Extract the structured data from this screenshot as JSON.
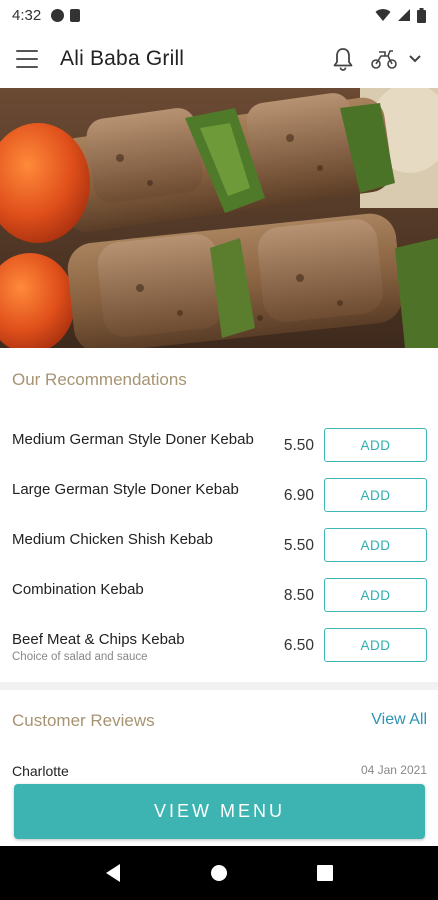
{
  "status_bar": {
    "time": "4:32",
    "icons_left": [
      "circle-icon",
      "card-icon"
    ],
    "icons_right": [
      "wifi-icon",
      "signal-icon",
      "battery-icon"
    ]
  },
  "app_bar": {
    "title": "Ali Baba Grill",
    "icons": [
      "menu-icon",
      "bell-icon",
      "delivery-scooter-icon",
      "chevron-down-icon"
    ]
  },
  "hero": {
    "image": "kebab skewers photo"
  },
  "recommendations": {
    "title": "Our Recommendations",
    "add_label": "ADD",
    "items": [
      {
        "name": "Medium German Style Doner Kebab",
        "price": "5.50",
        "subtitle": ""
      },
      {
        "name": "Large German Style Doner Kebab",
        "price": "6.90",
        "subtitle": ""
      },
      {
        "name": "Medium Chicken Shish Kebab",
        "price": "5.50",
        "subtitle": ""
      },
      {
        "name": "Combination Kebab",
        "price": "8.50",
        "subtitle": ""
      },
      {
        "name": "Beef Meat & Chips Kebab",
        "price": "6.50",
        "subtitle": "Choice of salad and sauce"
      }
    ]
  },
  "reviews": {
    "title": "Customer Reviews",
    "view_all": "View All",
    "first": {
      "name": "Charlotte",
      "date": "04 Jan 2021"
    }
  },
  "cta": {
    "label": "VIEW MENU"
  },
  "nav_bar": {
    "buttons": [
      "back-icon",
      "home-icon",
      "recents-icon"
    ]
  },
  "colors": {
    "accent": "#3db4b1",
    "section_title": "#a69472",
    "link": "#2e93b6"
  }
}
